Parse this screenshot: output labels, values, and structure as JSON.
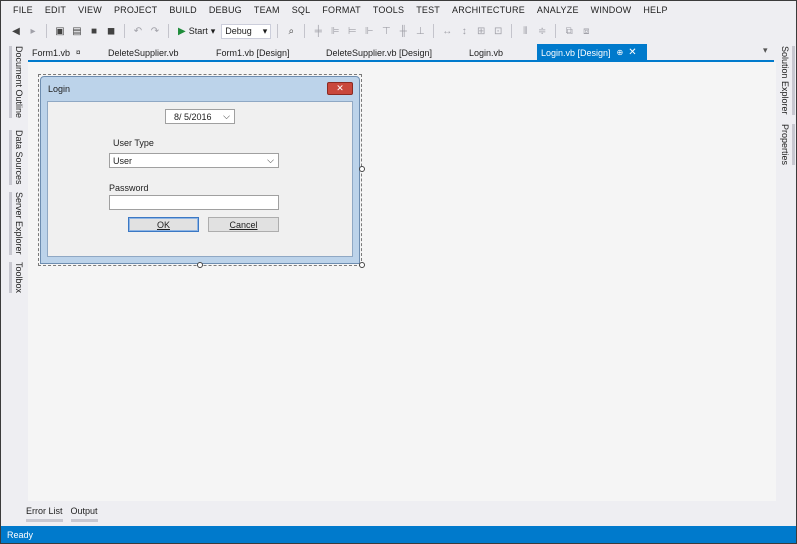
{
  "menu": [
    "FILE",
    "EDIT",
    "VIEW",
    "PROJECT",
    "BUILD",
    "DEBUG",
    "TEAM",
    "SQL",
    "FORMAT",
    "TOOLS",
    "TEST",
    "ARCHITECTURE",
    "ANALYZE",
    "WINDOW",
    "HELP"
  ],
  "toolbar": {
    "start_label": "Start",
    "config_value": "Debug"
  },
  "tabs": [
    {
      "label": "Form1.vb",
      "active": false,
      "pin": "¤"
    },
    {
      "label": "DeleteSupplier.vb",
      "active": false
    },
    {
      "label": "Form1.vb [Design]",
      "active": false
    },
    {
      "label": "DeleteSupplier.vb [Design]",
      "active": false
    },
    {
      "label": "Login.vb",
      "active": false
    },
    {
      "label": "Login.vb [Design]",
      "active": true
    }
  ],
  "left_panels": [
    "Document Outline",
    "Data Sources",
    "Server Explorer",
    "Toolbox"
  ],
  "right_panels": [
    "Solution Explorer",
    "Properties"
  ],
  "form": {
    "title": "Login",
    "close_glyph": "✕",
    "date_value": "8/  5/2016",
    "user_type_label": "User Type",
    "user_type_value": "User",
    "password_label": "Password",
    "password_value": "",
    "ok_label": "OK",
    "cancel_label": "Cancel"
  },
  "bottom_tabs": [
    "Error List",
    "Output"
  ],
  "status": "Ready",
  "colors": {
    "accent": "#007acc",
    "close_button": "#c9483c"
  }
}
